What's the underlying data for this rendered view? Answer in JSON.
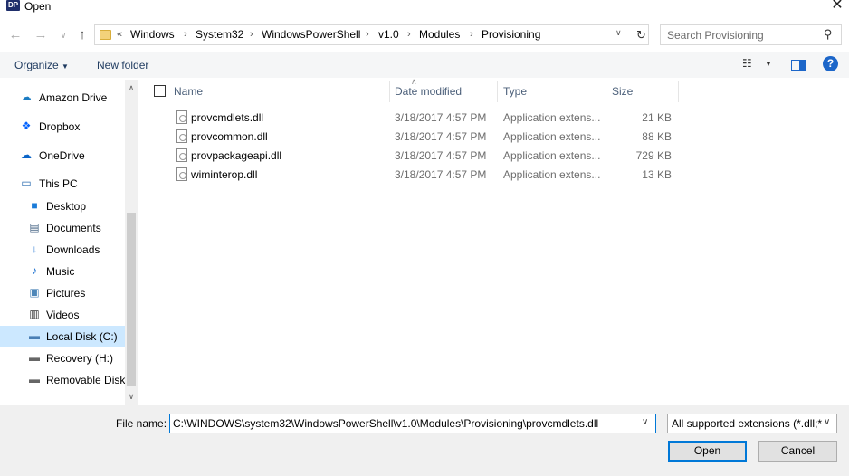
{
  "window": {
    "title": "Open",
    "app_icon_text": "DP"
  },
  "address": {
    "overflow": "«",
    "crumbs": [
      "Windows",
      "System32",
      "WindowsPowerShell",
      "v1.0",
      "Modules",
      "Provisioning"
    ]
  },
  "search": {
    "placeholder": "Search Provisioning"
  },
  "toolbar": {
    "organize_label": "Organize",
    "new_folder_label": "New folder"
  },
  "sidebar": {
    "items": [
      {
        "label": "Amazon Drive",
        "icon": "amazon-drive-icon"
      },
      {
        "label": "Dropbox",
        "icon": "dropbox-icon"
      },
      {
        "label": "OneDrive",
        "icon": "onedrive-icon"
      },
      {
        "label": "This PC",
        "icon": "computer-icon"
      },
      {
        "label": "Desktop",
        "icon": "desktop-icon"
      },
      {
        "label": "Documents",
        "icon": "documents-icon"
      },
      {
        "label": "Downloads",
        "icon": "downloads-icon"
      },
      {
        "label": "Music",
        "icon": "music-icon"
      },
      {
        "label": "Pictures",
        "icon": "pictures-icon"
      },
      {
        "label": "Videos",
        "icon": "videos-icon"
      },
      {
        "label": "Local Disk (C:)",
        "icon": "local-disk-icon",
        "selected": true
      },
      {
        "label": "Recovery (H:)",
        "icon": "drive-icon"
      },
      {
        "label": "Removable Disk",
        "icon": "removable-disk-icon"
      }
    ]
  },
  "columns": {
    "name": "Name",
    "date": "Date modified",
    "type": "Type",
    "size": "Size"
  },
  "files": [
    {
      "name": "provcmdlets.dll",
      "date": "3/18/2017 4:57 PM",
      "type": "Application extens...",
      "size": "21 KB"
    },
    {
      "name": "provcommon.dll",
      "date": "3/18/2017 4:57 PM",
      "type": "Application extens...",
      "size": "88 KB"
    },
    {
      "name": "provpackageapi.dll",
      "date": "3/18/2017 4:57 PM",
      "type": "Application extens...",
      "size": "729 KB"
    },
    {
      "name": "wiminterop.dll",
      "date": "3/18/2017 4:57 PM",
      "type": "Application extens...",
      "size": "13 KB"
    }
  ],
  "footer": {
    "file_name_label": "File name:",
    "file_name_value": "C:\\WINDOWS\\system32\\WindowsPowerShell\\v1.0\\Modules\\Provisioning\\provcmdlets.dll",
    "filter_value": "All supported extensions (*.dll;*",
    "open_label": "Open",
    "cancel_label": "Cancel"
  },
  "colors": {
    "accent": "#0078d7",
    "selection": "#cce8ff",
    "header_text": "#4c607a"
  }
}
